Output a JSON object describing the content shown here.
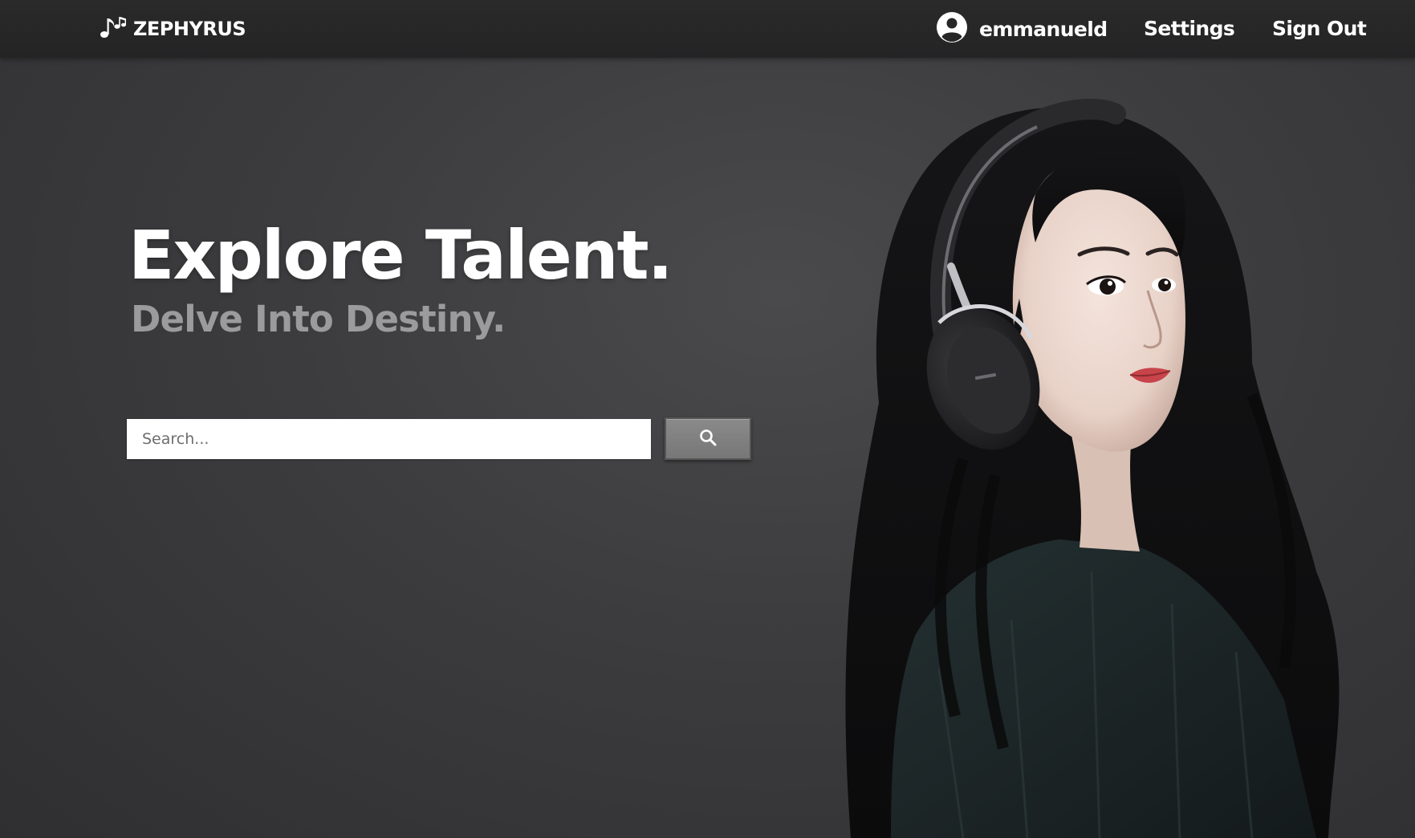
{
  "brand": {
    "name": "ZEPHYRUS",
    "logo_icon": "music-notes-icon"
  },
  "nav": {
    "username": "emmanueld",
    "user_icon": "user-circle-icon",
    "settings_label": "Settings",
    "signout_label": "Sign Out"
  },
  "hero": {
    "headline": "Explore Talent.",
    "subline": "Delve Into Destiny."
  },
  "search": {
    "placeholder": "Search...",
    "button_icon": "search-icon"
  },
  "colors": {
    "navbar": "#262627",
    "background": "#3a3a3c",
    "headline": "#ffffff",
    "subline": "#9b9b9d",
    "search_button": "#808080"
  }
}
